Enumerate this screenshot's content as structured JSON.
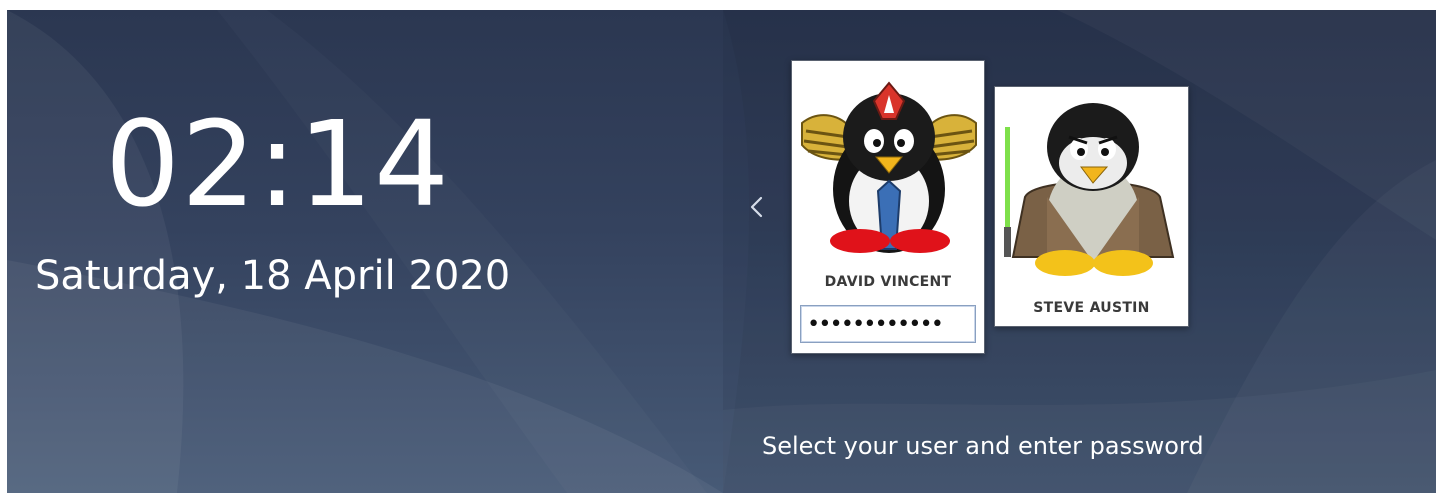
{
  "clock": {
    "time": "02:14",
    "date": "Saturday, 18 April 2020"
  },
  "users": [
    {
      "name": "DAVID VINCENT",
      "avatar_icon": "tux-penguin-avatar",
      "password_value": "••••••••••••",
      "selected": true
    },
    {
      "name": "STEVE AUSTIN",
      "avatar_icon": "tux-penguin-avatar"
    }
  ],
  "navigation": {
    "previous_icon": "chevron-left-icon"
  },
  "hint": {
    "text": "Select your user and enter password"
  },
  "colors": {
    "background_top": "#2b3751",
    "background_bottom": "#475a76",
    "text": "#ffffff",
    "card": "#ffffff"
  }
}
